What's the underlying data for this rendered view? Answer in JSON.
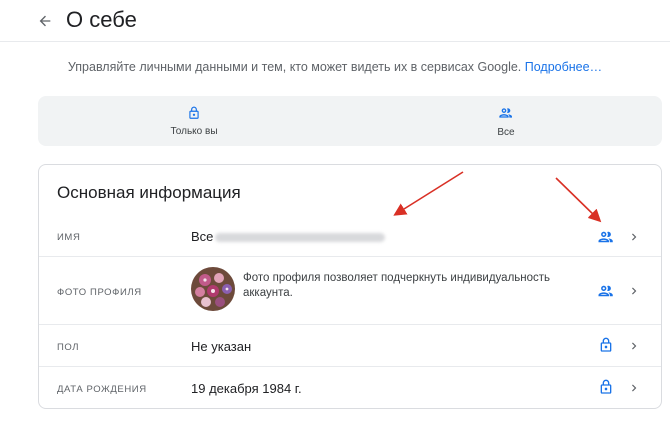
{
  "header": {
    "title": "О себе"
  },
  "intro": {
    "text": "Управляйте личными данными и тем, кто может видеть их в сервисах Google.",
    "link": "Подробнее…"
  },
  "legend": {
    "items": [
      {
        "label": "Только вы",
        "icon": "lock-icon"
      },
      {
        "label": "Все",
        "icon": "people-icon"
      }
    ]
  },
  "basic_info": {
    "title": "Основная информация",
    "rows": [
      {
        "label": "Имя",
        "value": "Все",
        "visibility_icon": "people-icon"
      },
      {
        "label": "Фото профиля",
        "value": "Фото профиля позволяет подчеркнуть индивидуальность аккаунта.",
        "visibility_icon": "people-icon"
      },
      {
        "label": "Пол",
        "value": "Не указан",
        "visibility_icon": "lock-icon"
      },
      {
        "label": "Дата рождения",
        "value": "19 декабря 1984 г.",
        "visibility_icon": "lock-icon"
      }
    ]
  },
  "colors": {
    "accent": "#1a73e8",
    "annotation_arrow": "#d93025",
    "legend_bg": "#f1f3f4",
    "border": "#dadce0"
  }
}
